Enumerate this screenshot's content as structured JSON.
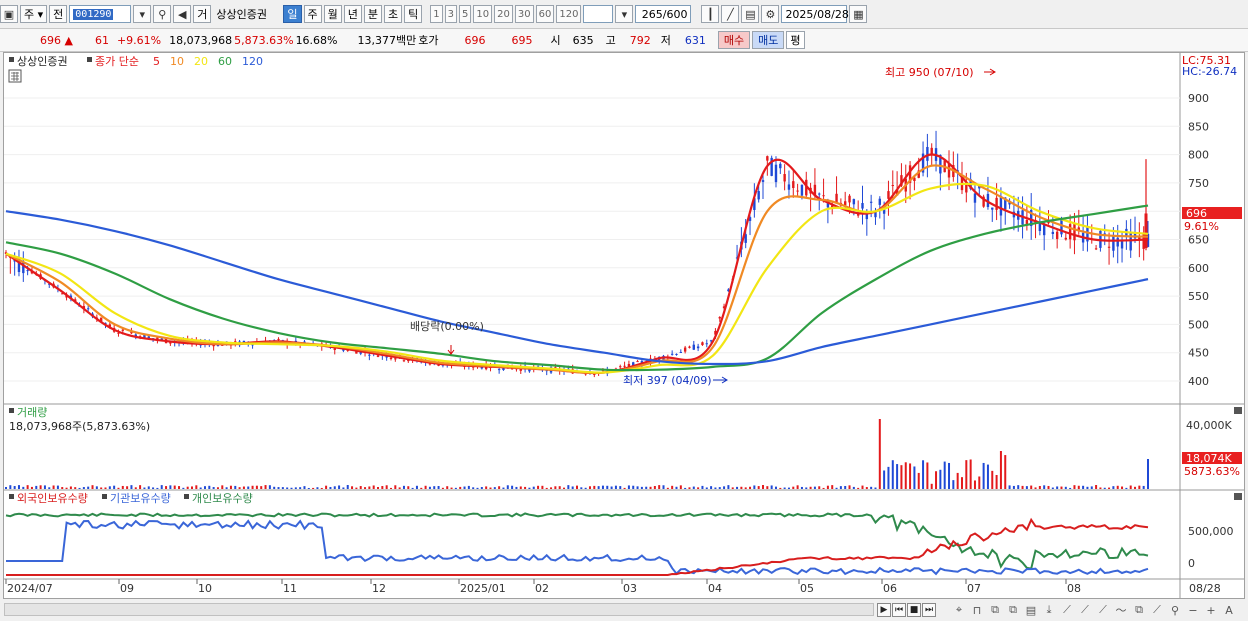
{
  "toolbar": {
    "tab_day_label": "주",
    "tab_prev_label": "전",
    "code_value": "001290",
    "name_mode_label": "거",
    "stock_name": "상상인증권",
    "periods": [
      "일",
      "주",
      "월",
      "년",
      "분",
      "초",
      "틱"
    ],
    "active_period": "일",
    "intervals": [
      "1",
      "3",
      "5",
      "10",
      "20",
      "30",
      "60",
      "120"
    ],
    "count_value": "265",
    "count_total": "/600",
    "date_value": "2025/08/28"
  },
  "quote": {
    "price": "696",
    "change": "61",
    "change_pct": "+9.61%",
    "volume": "18,073,968",
    "volume_ratio": "5,873.63%",
    "turnover": "16.68%",
    "amount": "13,377백만",
    "ask_label": "호가",
    "ask": "696",
    "bid": "695",
    "open_label": "시",
    "open": "635",
    "high_label": "고",
    "high": "792",
    "low_label": "저",
    "low": "631",
    "buy_label": "매수",
    "sell_label": "매도",
    "eval_label": "평"
  },
  "chart": {
    "legend_name": "상상인증권",
    "legend_ma": "종가 단순",
    "ma_periods": [
      "5",
      "10",
      "20",
      "60",
      "120"
    ],
    "lc": "LC:75.31",
    "hc": "HC:-26.74",
    "price_ticks": [
      "900",
      "850",
      "800",
      "750",
      "700",
      "650",
      "600",
      "550",
      "500",
      "450",
      "400"
    ],
    "current_price_tag": "696",
    "current_pct_tag": "9.61%",
    "high_annotation": "최고 950 (07/10)",
    "low_annotation": "최저 397 (04/09)",
    "dividend_annotation": "배당락(0.00%)",
    "volume_title": "거래량",
    "volume_value": "18,073,968주(5,873.63%)",
    "volume_tick": "40,000K",
    "volume_tag": "18,074K",
    "volume_pct_tag": "5873.63%",
    "holding_titles": [
      "외국인보유수량",
      "기관보유수량",
      "개인보유수량"
    ],
    "holding_ticks": [
      "500,000",
      "0"
    ],
    "x_labels": [
      "2024/07",
      "09",
      "10",
      "11",
      "12",
      "2025/01",
      "02",
      "03",
      "04",
      "05",
      "06",
      "07",
      "08"
    ],
    "x_last_label": "08/28"
  },
  "colors": {
    "ma5": "#e31a1c",
    "ma10": "#f08a24",
    "ma20": "#f2e614",
    "ma60": "#2f9e44",
    "ma120": "#2b5bd7",
    "foreign": "#2f8a4c",
    "institution": "#3a66d8",
    "individual": "#d81e1e"
  },
  "chart_data": {
    "type": "candlestick",
    "price_axis": [
      400,
      900
    ],
    "high": {
      "value": 950,
      "date": "07/10"
    },
    "low": {
      "value": 397,
      "date": "04/09"
    },
    "last_close": 696,
    "series": [
      {
        "name": "5",
        "values": [
          625,
          560,
          490,
          470,
          465,
          470,
          460,
          445,
          430,
          425,
          420,
          415,
          440,
          470,
          780,
          720,
          700,
          800,
          720,
          680,
          650,
          650
        ]
      },
      {
        "name": "10",
        "values": [
          625,
          575,
          500,
          475,
          465,
          468,
          462,
          448,
          432,
          426,
          420,
          415,
          435,
          460,
          700,
          720,
          700,
          780,
          740,
          690,
          660,
          655
        ]
      },
      {
        "name": "20",
        "values": [
          625,
          590,
          520,
          480,
          468,
          465,
          462,
          452,
          436,
          428,
          422,
          415,
          428,
          445,
          600,
          700,
          700,
          740,
          745,
          700,
          670,
          660
        ]
      },
      {
        "name": "60",
        "values": [
          645,
          625,
          590,
          545,
          510,
          485,
          468,
          458,
          448,
          435,
          428,
          420,
          420,
          425,
          440,
          520,
          580,
          630,
          660,
          680,
          695,
          710
        ]
      },
      {
        "name": "120",
        "values": [
          700,
          685,
          665,
          640,
          610,
          580,
          555,
          530,
          505,
          485,
          465,
          450,
          435,
          430,
          435,
          460,
          480,
          500,
          520,
          540,
          560,
          580
        ]
      }
    ]
  }
}
